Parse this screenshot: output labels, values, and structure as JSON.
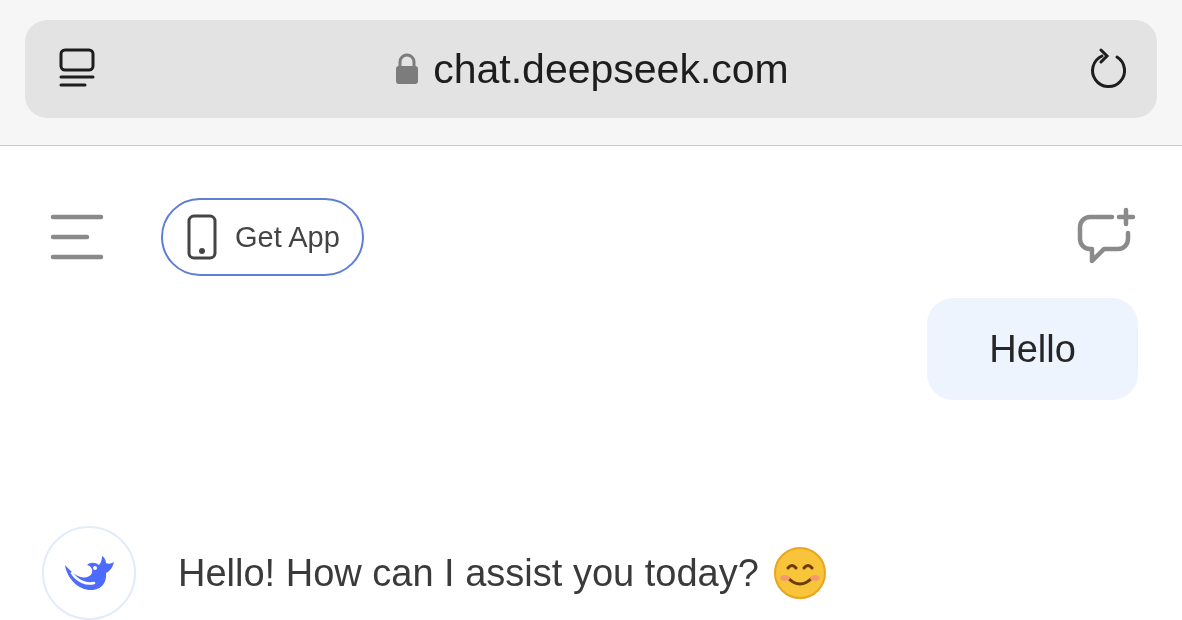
{
  "browser": {
    "url": "chat.deepseek.com",
    "secure": true
  },
  "header": {
    "get_app": "Get App"
  },
  "messages": [
    {
      "kind": "user",
      "text": "Hello"
    },
    {
      "kind": "assistant",
      "text": "Hello! How can I assist you today?"
    }
  ]
}
